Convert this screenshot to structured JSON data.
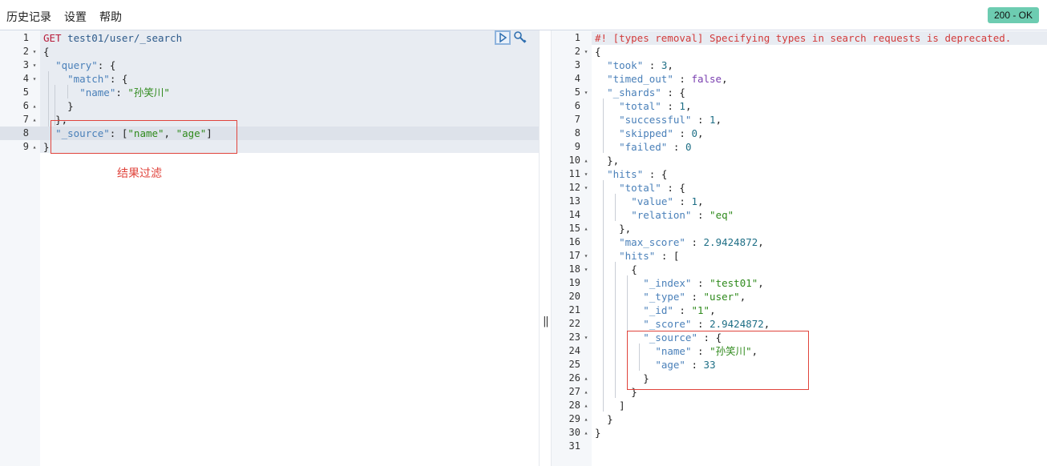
{
  "menu": {
    "history": "历史记录",
    "settings": "设置",
    "help": "帮助"
  },
  "status": {
    "label": "200 - OK",
    "color": "#6dccb1"
  },
  "annotation": {
    "label": "结果过滤",
    "color": "#e0443c"
  },
  "toolbar": {
    "run_icon": "play-icon",
    "settings_icon": "wrench-icon"
  },
  "request": {
    "lines": [
      {
        "num": "1",
        "fold": "",
        "text": "GET test01/user/_search"
      },
      {
        "num": "2",
        "fold": "▾",
        "text": "{"
      },
      {
        "num": "3",
        "fold": "▾",
        "text": "  \"query\": {"
      },
      {
        "num": "4",
        "fold": "▾",
        "text": "    \"match\": {"
      },
      {
        "num": "5",
        "fold": "",
        "text": "      \"name\": \"孙笑川\""
      },
      {
        "num": "6",
        "fold": "▴",
        "text": "    }"
      },
      {
        "num": "7",
        "fold": "▴",
        "text": "  },"
      },
      {
        "num": "8",
        "fold": "",
        "text": "  \"_source\": [\"name\", \"age\"]"
      },
      {
        "num": "9",
        "fold": "▴",
        "text": "}"
      }
    ]
  },
  "response": {
    "lines": [
      {
        "num": "1",
        "fold": "",
        "text": "#! [types removal] Specifying types in search requests is deprecated."
      },
      {
        "num": "2",
        "fold": "▾",
        "text": "{"
      },
      {
        "num": "3",
        "fold": "",
        "text": "  \"took\" : 3,"
      },
      {
        "num": "4",
        "fold": "",
        "text": "  \"timed_out\" : false,"
      },
      {
        "num": "5",
        "fold": "▾",
        "text": "  \"_shards\" : {"
      },
      {
        "num": "6",
        "fold": "",
        "text": "    \"total\" : 1,"
      },
      {
        "num": "7",
        "fold": "",
        "text": "    \"successful\" : 1,"
      },
      {
        "num": "8",
        "fold": "",
        "text": "    \"skipped\" : 0,"
      },
      {
        "num": "9",
        "fold": "",
        "text": "    \"failed\" : 0"
      },
      {
        "num": "10",
        "fold": "▴",
        "text": "  },"
      },
      {
        "num": "11",
        "fold": "▾",
        "text": "  \"hits\" : {"
      },
      {
        "num": "12",
        "fold": "▾",
        "text": "    \"total\" : {"
      },
      {
        "num": "13",
        "fold": "",
        "text": "      \"value\" : 1,"
      },
      {
        "num": "14",
        "fold": "",
        "text": "      \"relation\" : \"eq\""
      },
      {
        "num": "15",
        "fold": "▴",
        "text": "    },"
      },
      {
        "num": "16",
        "fold": "",
        "text": "    \"max_score\" : 2.9424872,"
      },
      {
        "num": "17",
        "fold": "▾",
        "text": "    \"hits\" : ["
      },
      {
        "num": "18",
        "fold": "▾",
        "text": "      {"
      },
      {
        "num": "19",
        "fold": "",
        "text": "        \"_index\" : \"test01\","
      },
      {
        "num": "20",
        "fold": "",
        "text": "        \"_type\" : \"user\","
      },
      {
        "num": "21",
        "fold": "",
        "text": "        \"_id\" : \"1\","
      },
      {
        "num": "22",
        "fold": "",
        "text": "        \"_score\" : 2.9424872,"
      },
      {
        "num": "23",
        "fold": "▾",
        "text": "        \"_source\" : {"
      },
      {
        "num": "24",
        "fold": "",
        "text": "          \"name\" : \"孙笑川\","
      },
      {
        "num": "25",
        "fold": "",
        "text": "          \"age\" : 33"
      },
      {
        "num": "26",
        "fold": "▴",
        "text": "        }"
      },
      {
        "num": "27",
        "fold": "▴",
        "text": "      }"
      },
      {
        "num": "28",
        "fold": "▴",
        "text": "    ]"
      },
      {
        "num": "29",
        "fold": "▴",
        "text": "  }"
      },
      {
        "num": "30",
        "fold": "▴",
        "text": "}"
      },
      {
        "num": "31",
        "fold": "",
        "text": ""
      }
    ]
  }
}
